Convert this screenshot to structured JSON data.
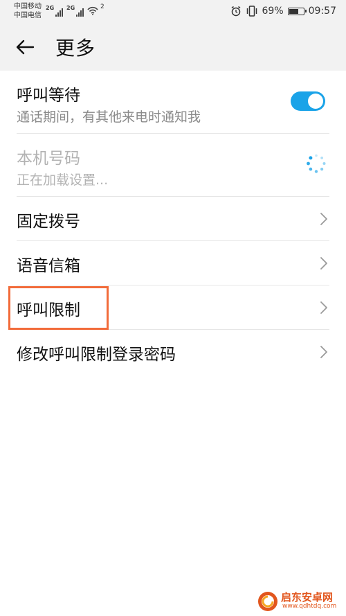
{
  "status_bar": {
    "carrier_1": "中国移动",
    "carrier_2": "中国电信",
    "network_1": "2G",
    "network_2": "2G",
    "hotspot_count": "2",
    "battery": "69%",
    "battery_level": 0.69,
    "time": "09:57",
    "icons": [
      "alarm-icon",
      "vibrate-icon",
      "battery-icon"
    ]
  },
  "header": {
    "title": "更多",
    "back_icon": "back-arrow-icon"
  },
  "list": {
    "call_waiting": {
      "title": "呼叫等待",
      "subtitle": "通话期间，有其他来电时通知我",
      "toggle_on": true
    },
    "my_number": {
      "title": "本机号码",
      "subtitle": "正在加载设置..."
    },
    "fixed_dialing": {
      "title": "固定拨号"
    },
    "voicemail": {
      "title": "语音信箱"
    },
    "call_barring": {
      "title": "呼叫限制"
    },
    "change_barring_password": {
      "title": "修改呼叫限制登录密码"
    }
  },
  "watermark": {
    "name": "启东安卓网",
    "url": "www.qdhtdq.com"
  },
  "colors": {
    "accent": "#1aa3e8",
    "highlight": "#f26b3a",
    "header_bg": "#f2f2f2"
  }
}
